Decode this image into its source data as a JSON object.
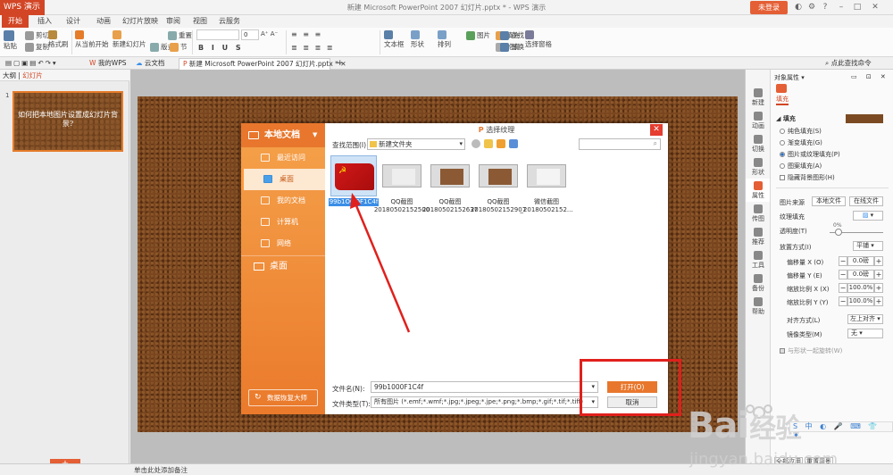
{
  "app": {
    "menu_button": "WPS 演示",
    "window_title": "新建 Microsoft PowerPoint 2007 幻灯片.pptx * - WPS 演示",
    "login_button": "未登录"
  },
  "ribbon_tabs": [
    "开始",
    "插入",
    "设计",
    "动画",
    "幻灯片放映",
    "审阅",
    "视图",
    "云服务"
  ],
  "ribbon": {
    "paste": "粘贴",
    "cut": "剪切",
    "copy": "复制",
    "format_painter": "格式刷",
    "from_current": "从当前开始",
    "new_slide": "新建幻灯片",
    "layout": "版式",
    "section": "节",
    "reset": "重置",
    "font_size": "0",
    "textbox": "文本框",
    "shape": "形状",
    "arrange": "排列",
    "picture": "图片",
    "fill": "填充",
    "outline": "轮廓",
    "find": "查找",
    "replace": "替换",
    "select_pane": "选择窗格"
  },
  "doc_tabs": {
    "my_wps": "我的WPS",
    "cloud_docs": "云文档",
    "current": "新建 Microsoft PowerPoint 2007 幻灯片.pptx *",
    "add": "+",
    "right_search": "点此查找命令"
  },
  "left_pane": {
    "tab_outline": "大纲",
    "tab_slides": "幻灯片",
    "slide_number": "1",
    "slide_title": "如何把本地图片设置成幻灯片背景?",
    "add_slide": "+"
  },
  "dialog": {
    "title": "选择纹理",
    "side_header": "本地文档",
    "side_items": [
      "最近访问",
      "桌面",
      "我的文档",
      "计算机",
      "网络"
    ],
    "side_desktop": "桌面",
    "recover": "数据恢复大师",
    "scope_label": "查找范围(I):",
    "scope_value": "新建文件夹",
    "files": [
      {
        "name": "99b1OOOF1C4f",
        "selected": true,
        "kind": "flag"
      },
      {
        "name": "QQ截图20180502152500",
        "short": "QQ截图\n20180502152500",
        "selected": false,
        "kind": "shot"
      },
      {
        "name": "QQ截图20180502152637",
        "short": "QQ截图\n20180502152637",
        "selected": false,
        "kind": "shot"
      },
      {
        "name": "QQ截图20180502152907",
        "short": "QQ截图\n20180502152907",
        "selected": false,
        "kind": "shot"
      },
      {
        "name": "微信截图_20180502152...",
        "short": "微信截图\n_20180502152...",
        "selected": false,
        "kind": "light"
      }
    ],
    "filename_label": "文件名(N):",
    "filename_value": "99b1000F1C4f",
    "filetype_label": "文件类型(T):",
    "filetype_value": "所有图片 (*.emf;*.wmf;*.jpg;*.jpeg;*.jpe;*.png;*.bmp;*.gif;*.tif;*.tiff)",
    "open_button": "打开(O)",
    "cancel_button": "取消"
  },
  "right_icons": [
    "新建",
    "动画",
    "切换",
    "形状",
    "属性",
    "传图",
    "推荐",
    "工具",
    "备份",
    "帮助"
  ],
  "props": {
    "header": "对象属性",
    "tab": "填充",
    "section": "填充",
    "options": [
      "纯色填充(S)",
      "渐变填充(G)",
      "图片或纹理填充(P)",
      "图案填充(A)"
    ],
    "selected_option": 2,
    "hide_bg": "隐藏背景图形(H)",
    "picture_source": "图片来源",
    "local_file": "本地文件",
    "online_file": "在线文件",
    "texture_fill": "纹理填充",
    "transparency": "透明度(T)",
    "transparency_value": "0%",
    "placement": "放置方式(I)",
    "placement_value": "平铺",
    "offset_x": "偏移量 X (O)",
    "offset_x_value": "0.0磅",
    "offset_y": "偏移量 Y (E)",
    "offset_y_value": "0.0磅",
    "scale_x": "缩放比例 X (X)",
    "scale_x_value": "100.0%",
    "scale_y": "缩放比例 Y (Y)",
    "scale_y_value": "100.0%",
    "align": "对齐方式(L)",
    "align_value": "左上对齐",
    "mirror": "镜像类型(M)",
    "mirror_value": "无",
    "rotate_with_shape": "与形状一起旋转(W)",
    "apply_all": "全部应用",
    "reset_bg": "重置背景"
  },
  "status": {
    "notes_hint": "单击此处添加备注"
  },
  "watermark": {
    "brand": "Bai",
    "brand_cn": "经验",
    "url": "jingyan.baidu.com"
  },
  "colors": {
    "accent": "#d24625",
    "dialog_orange": "#e8772d",
    "annotation_red": "#e0201c"
  }
}
